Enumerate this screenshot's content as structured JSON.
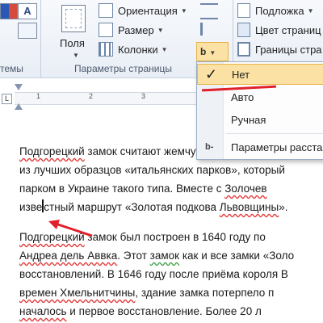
{
  "ribbon": {
    "orientation_label": "Ориентация",
    "size_label": "Размер",
    "columns_label": "Колонки",
    "fields_label": "Поля",
    "group_page_setup": "Параметры страницы",
    "group_themes_partial": "темы",
    "background_label": "Подложка",
    "page_color_label": "Цвет страниц",
    "page_borders_label": "Границы стра"
  },
  "ruler": {
    "numbers": [
      "1",
      "2",
      "3"
    ]
  },
  "hyphenation_menu": {
    "items": [
      {
        "label": "Нет",
        "selected": true
      },
      {
        "label": "Авто",
        "selected": false
      },
      {
        "label": "Ручная",
        "selected": false
      },
      {
        "label": "Параметры расста",
        "selected": false
      }
    ]
  },
  "document": {
    "p1": [
      [
        "Подгорецкий",
        " замок считают жемчужиной европейско"
      ],
      [
        "из лучших образцов «итальянских парков», который"
      ],
      [
        "парком в Украине такого типа. Вместе с ",
        "Золочев"
      ],
      [
        "изве",
        "стный маршрут «Золотая подкова ",
        "Львовщины",
        "»."
      ]
    ],
    "p2": [
      [
        "Подгорецкий",
        " замок был построен в 1640 году по"
      ],
      [
        "Андреа дель Аввка",
        ". Этот ",
        "замок",
        " как и все замки «Золо"
      ],
      [
        "восстановлений. В 1646 году после приёма короля В"
      ],
      [
        "времен Хмельнитчины",
        ", здание замка потерпело п"
      ],
      [
        "началось",
        " и первое восстановление. Более 20 л"
      ]
    ]
  },
  "colors": {
    "accent_red": "#e0202a",
    "menu_highlight": "#fbe2a4",
    "ribbon_bg": "#e9eef6"
  }
}
